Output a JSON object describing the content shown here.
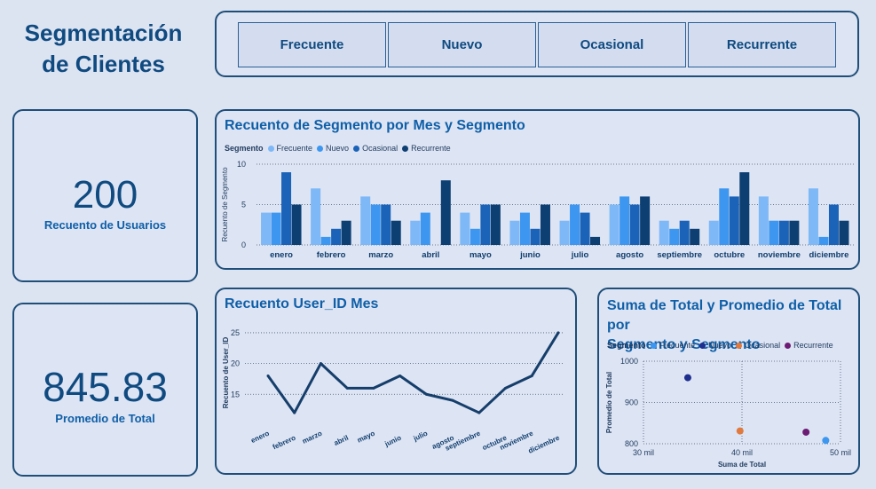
{
  "page": {
    "title_line1": "Segmentación",
    "title_line2": "de Clientes"
  },
  "slicer": {
    "options": [
      "Frecuente",
      "Nuevo",
      "Ocasional",
      "Recurrente"
    ]
  },
  "kpis": {
    "users": {
      "value": "200",
      "label": "Recuento de Usuarios"
    },
    "avg_total": {
      "value": "845.83",
      "label": "Promedio de Total"
    }
  },
  "colors": {
    "frecuente": "#7eb8f7",
    "nuevo": "#3d96f0",
    "ocasional": "#1a63b8",
    "recurrente": "#0d3f73",
    "line": "#163e6b",
    "scatter_frecuente": "#3d96f0",
    "scatter_nuevo": "#1f2f8f",
    "scatter_ocasional": "#e07a3e",
    "scatter_recurrente": "#6d1c74"
  },
  "chart_data": [
    {
      "type": "bar",
      "title": "Recuento de Segmento por Mes y Segmento",
      "legend_title": "Segmento",
      "ylabel": "Recuento de Segmento",
      "xlabel": "",
      "ylim": [
        0,
        10
      ],
      "yticks": [
        0,
        5,
        10
      ],
      "grid": true,
      "legend_position": "top-left",
      "categories": [
        "enero",
        "febrero",
        "marzo",
        "abril",
        "mayo",
        "junio",
        "julio",
        "agosto",
        "septiembre",
        "octubre",
        "noviembre",
        "diciembre"
      ],
      "series": [
        {
          "name": "Frecuente",
          "values": [
            4,
            7,
            6,
            3,
            4,
            3,
            3,
            5,
            3,
            3,
            6,
            7
          ]
        },
        {
          "name": "Nuevo",
          "values": [
            4,
            1,
            5,
            4,
            2,
            4,
            5,
            6,
            2,
            7,
            3,
            1
          ]
        },
        {
          "name": "Ocasional",
          "values": [
            9,
            2,
            5,
            0,
            5,
            2,
            4,
            5,
            3,
            6,
            3,
            5
          ]
        },
        {
          "name": "Recurrente",
          "values": [
            5,
            3,
            3,
            8,
            5,
            5,
            1,
            6,
            2,
            9,
            3,
            3
          ]
        }
      ]
    },
    {
      "type": "line",
      "title": "Recuento User_ID Mes",
      "ylabel": "Recuento de User_ID",
      "xlabel": "",
      "ylim": [
        11,
        26
      ],
      "yticks": [
        15,
        20,
        25
      ],
      "grid": true,
      "categories": [
        "enero",
        "febrero",
        "marzo",
        "abril",
        "mayo",
        "junio",
        "julio",
        "agosto",
        "septiembre",
        "octubre",
        "noviembre",
        "diciembre"
      ],
      "values": [
        18,
        12,
        20,
        16,
        16,
        18,
        15,
        14,
        12,
        16,
        18,
        25
      ]
    },
    {
      "type": "scatter",
      "title_line1": "Suma de Total y Promedio de Total por",
      "title_line2": "Segmento y Segmento",
      "legend_title": "Segmento",
      "xlabel": "Suma de Total",
      "ylabel": "Promedio de Total",
      "xlim": [
        30000,
        50000
      ],
      "ylim": [
        800,
        1000
      ],
      "xticks": [
        {
          "v": 30000,
          "label": "30 mil"
        },
        {
          "v": 40000,
          "label": "40 mil"
        },
        {
          "v": 50000,
          "label": "50 mil"
        }
      ],
      "yticks": [
        800,
        900,
        1000
      ],
      "grid": true,
      "points": [
        {
          "name": "Frecuente",
          "x": 48500,
          "y": 808
        },
        {
          "name": "Nuevo",
          "x": 34500,
          "y": 960
        },
        {
          "name": "Ocasional",
          "x": 39800,
          "y": 831
        },
        {
          "name": "Recurrente",
          "x": 46500,
          "y": 828
        }
      ]
    }
  ]
}
